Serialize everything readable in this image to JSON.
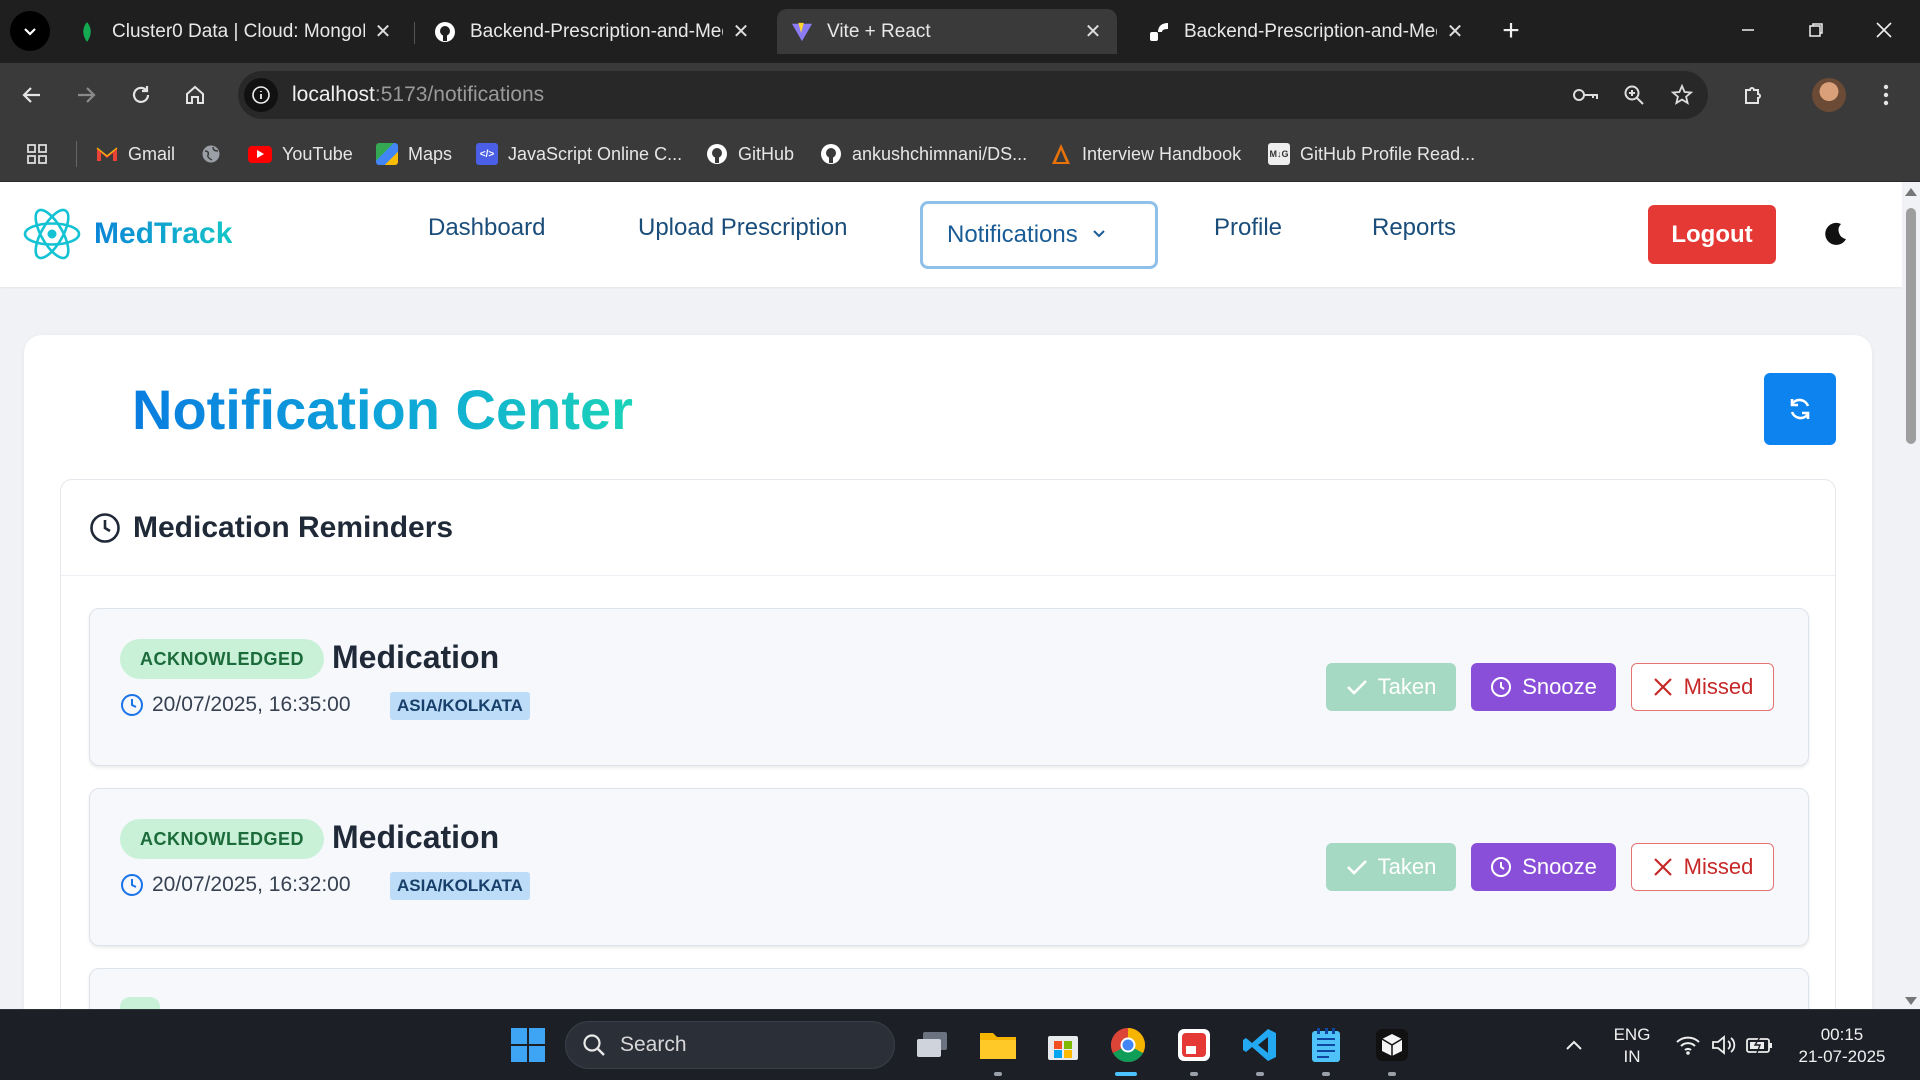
{
  "browser": {
    "tabs": [
      {
        "title": "Cluster0 Data | Cloud: MongoDB",
        "active": false
      },
      {
        "title": "Backend-Prescription-and-Medic",
        "active": false
      },
      {
        "title": "Vite + React",
        "active": true
      },
      {
        "title": "Backend-Prescription-and-Medic",
        "active": false
      }
    ],
    "url_host": "localhost",
    "url_path": ":5173/notifications",
    "bookmarks": [
      {
        "label": "Gmail",
        "icon": "gmail-icon"
      },
      {
        "label": "",
        "icon": "globe-icon"
      },
      {
        "label": "YouTube",
        "icon": "youtube-icon"
      },
      {
        "label": "Maps",
        "icon": "maps-icon"
      },
      {
        "label": "JavaScript Online C...",
        "icon": "code-icon"
      },
      {
        "label": "GitHub",
        "icon": "github-icon"
      },
      {
        "label": "ankushchimnani/DS...",
        "icon": "github-icon"
      },
      {
        "label": "Interview Handbook",
        "icon": "handbook-icon"
      },
      {
        "label": "GitHub Profile Read...",
        "icon": "readme-icon"
      }
    ]
  },
  "app": {
    "brand": "MedTrack",
    "nav": {
      "dashboard": "Dashboard",
      "upload": "Upload Prescription",
      "notifications": "Notifications",
      "profile": "Profile",
      "reports": "Reports"
    },
    "logout": "Logout",
    "colors": {
      "accent": "#0d83ef",
      "danger": "#e53935",
      "snooze": "#8a4fd8",
      "taken": "#a5d9c3"
    }
  },
  "main": {
    "title_part1": "Notification",
    "title_part2": "Center",
    "section_title": "Medication Reminders",
    "reminders": [
      {
        "status": "ACKNOWLEDGED",
        "title": "Medication",
        "datetime": "20/07/2025, 16:35:00",
        "timezone": "ASIA/KOLKATA"
      },
      {
        "status": "ACKNOWLEDGED",
        "title": "Medication",
        "datetime": "20/07/2025, 16:32:00",
        "timezone": "ASIA/KOLKATA"
      }
    ],
    "actions": {
      "taken": "Taken",
      "snooze": "Snooze",
      "missed": "Missed"
    }
  },
  "taskbar": {
    "search": "Search",
    "lang_top": "ENG",
    "lang_bottom": "IN",
    "time": "00:15",
    "date": "21-07-2025"
  }
}
